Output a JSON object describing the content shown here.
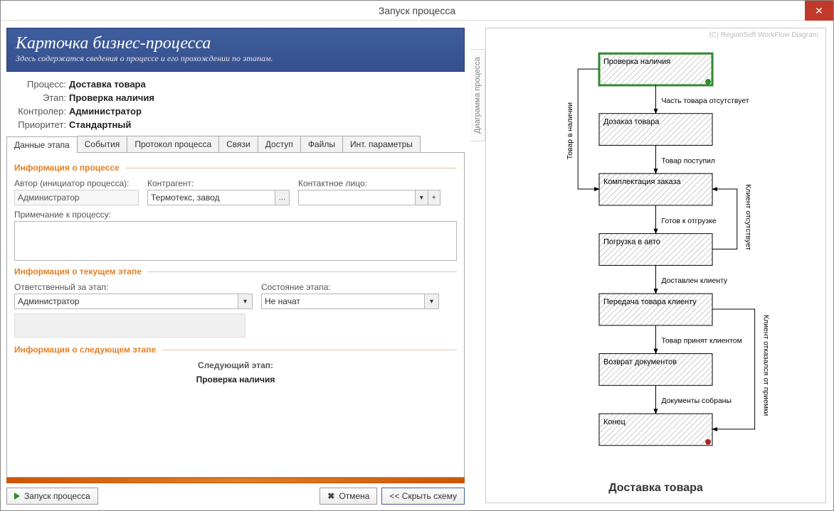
{
  "window": {
    "title": "Запуск процесса"
  },
  "banner": {
    "title": "Карточка бизнес-процесса",
    "subtitle": "Здесь содержатся сведения о процессе и его прохождении по этапам."
  },
  "props": {
    "process_label": "Процесс:",
    "process_value": "Доставка товара",
    "stage_label": "Этап:",
    "stage_value": "Проверка наличия",
    "controller_label": "Контролер:",
    "controller_value": "Администратор",
    "priority_label": "Приоритет:",
    "priority_value": "Стандартный"
  },
  "tabs": {
    "t0": "Данные этапа",
    "t1": "События",
    "t2": "Протокол процесса",
    "t3": "Связи",
    "t4": "Доступ",
    "t5": "Файлы",
    "t6": "Инт. параметры"
  },
  "sections": {
    "process_info": "Информация о процессе",
    "current_stage": "Информация о текущем этапе",
    "next_stage_title": "Информация о следующем этапе"
  },
  "form": {
    "author_label": "Автор (инициатор процесса):",
    "author_value": "Администратор",
    "counterparty_label": "Контрагент:",
    "counterparty_value": "Термотекс, завод",
    "contact_label": "Контактное лицо:",
    "contact_value": "",
    "note_label": "Примечание к процессу:",
    "note_value": "",
    "responsible_label": "Ответственный за этап:",
    "responsible_value": "Администратор",
    "state_label": "Состояние этапа:",
    "state_value": "Не начат",
    "next_stage_label": "Следующий этап:",
    "next_stage_value": "Проверка наличия"
  },
  "buttons": {
    "start": "Запуск процесса",
    "cancel": "Отмена",
    "hide_scheme": "<< Скрыть схему",
    "ellipsis": "…",
    "dropdown": "▾",
    "plus": "+"
  },
  "diagram": {
    "vtab": "Диаграмма процесса",
    "copyright": "(C) RegionSoft WorkFlow Diagram",
    "title": "Доставка товара",
    "nodes": {
      "n1": "Проверка наличия",
      "n2": "Дозаказ товара",
      "n3": "Комплектация заказа",
      "n4": "Погрузка в авто",
      "n5": "Передача товара клиенту",
      "n6": "Возврат документов",
      "n7": "Конец"
    },
    "edges": {
      "e_back_stock": "Товар в наличии",
      "e12": "Часть товара отсутствует",
      "e23": "Товар поступил",
      "e34": "Готов к отгрузке",
      "e_back_client": "Клиент отсутствует",
      "e45": "Доставлен клиенту",
      "e56": "Товар принят клиентом",
      "e_back_refuse": "Клиент отказался от приемки",
      "e67": "Документы собраны"
    }
  }
}
